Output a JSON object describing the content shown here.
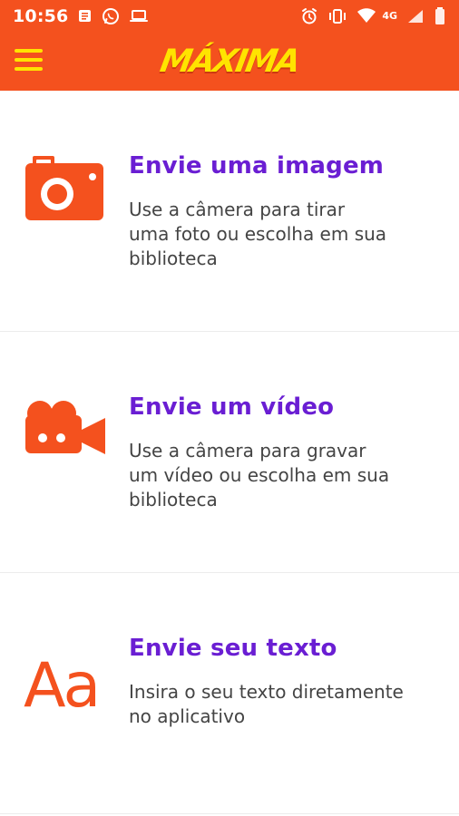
{
  "status_bar": {
    "time": "10:56",
    "network": "4G"
  },
  "app_bar": {
    "logo_text": "MÁXIMA"
  },
  "items": [
    {
      "title": "Envie uma imagem",
      "description": [
        "Use a câmera para tirar",
        "uma foto ou escolha em sua",
        "biblioteca"
      ],
      "icon": "camera-icon"
    },
    {
      "title": "Envie um vídeo",
      "description": [
        "Use a câmera para gravar",
        "um vídeo ou escolha em sua",
        "biblioteca"
      ],
      "icon": "video-camera-icon"
    },
    {
      "title": "Envie seu texto",
      "description": [
        "Insira o seu texto diretamente",
        "no aplicativo"
      ],
      "icon": "text-icon",
      "icon_text": "Aa"
    }
  ],
  "colors": {
    "brand": "#f4511e",
    "accent": "#ffe400",
    "title": "#6a1ed3",
    "text": "#444444"
  }
}
